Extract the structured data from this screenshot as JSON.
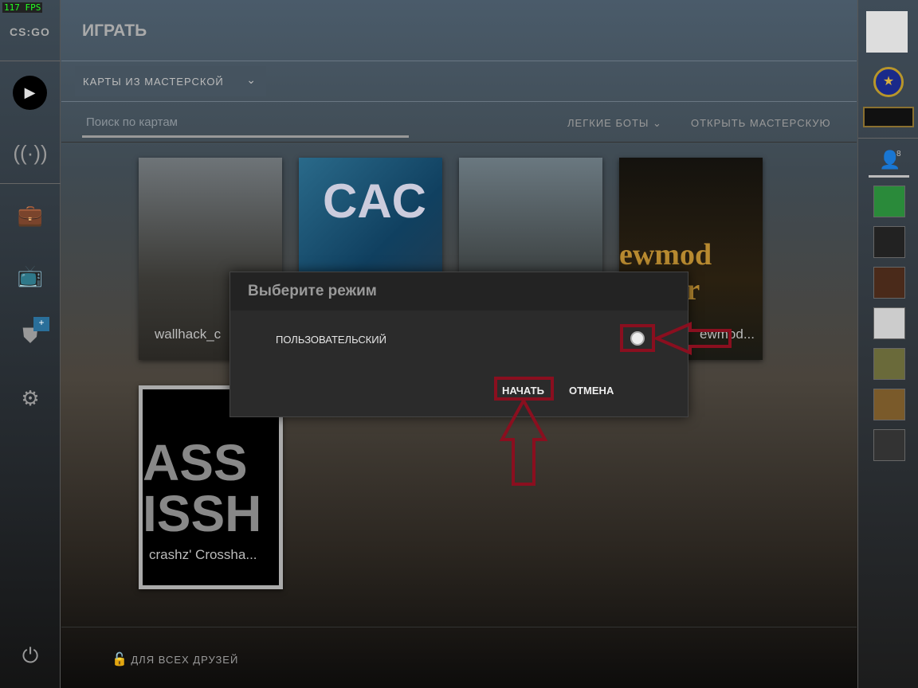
{
  "fps": "117 FPS",
  "logo": "CS:GO",
  "header": {
    "title": "ИГРАТЬ"
  },
  "mode_dropdown": {
    "value": "КАРТЫ ИЗ МАСТЕРСКОЙ"
  },
  "search": {
    "placeholder": "Поиск по картам"
  },
  "toolbar": {
    "bots": "ЛЕГКИЕ БОТЫ",
    "open_workshop": "ОТКРЫТЬ МАСТЕРСКУЮ"
  },
  "sidebar": {
    "items": [
      {
        "icon": "play-icon"
      },
      {
        "icon": "broadcast-icon"
      },
      {
        "icon": "inventory-icon"
      },
      {
        "icon": "tv-icon"
      },
      {
        "icon": "shield-icon",
        "badge": "+"
      },
      {
        "icon": "gear-icon"
      },
      {
        "icon": "power-icon"
      }
    ]
  },
  "maps": [
    {
      "label": "wallhack_c"
    },
    {
      "label": "CAC"
    },
    {
      "label": ""
    },
    {
      "label": "ewmod..."
    },
    {
      "label": "crashz' Crossha..."
    }
  ],
  "dialog": {
    "title": "Выберите режим",
    "option": "ПОЛЬЗОВАТЕЛЬСКИЙ",
    "start": "НАЧАТЬ",
    "cancel": "ОТМЕНА"
  },
  "footer": {
    "privacy": "ДЛЯ ВСЕХ ДРУЗЕЙ"
  },
  "friends": {
    "count": "8"
  },
  "colors": {
    "highlight": "#8a0f1f",
    "fps": "#22ff22"
  }
}
